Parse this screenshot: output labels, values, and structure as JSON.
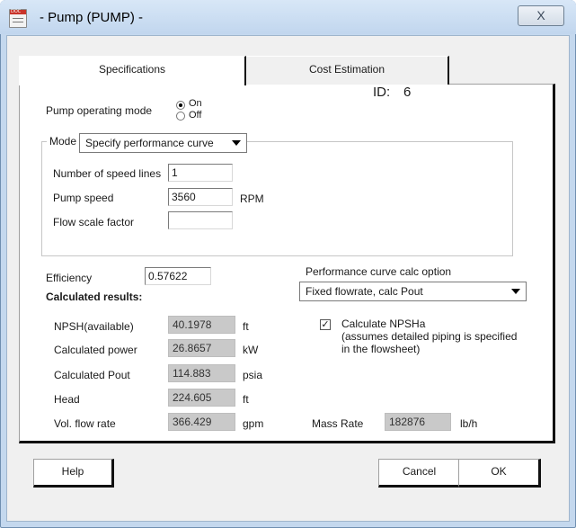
{
  "window": {
    "title": "- Pump (PUMP) -",
    "close_glyph": "X",
    "app_icon": "document-icon"
  },
  "tabs": [
    {
      "label": "Specifications"
    },
    {
      "label": "Cost Estimation"
    }
  ],
  "id": {
    "label": "ID:",
    "value": "6"
  },
  "operating_mode": {
    "label": "Pump operating mode",
    "options": [
      "On",
      "Off"
    ],
    "selected": "On"
  },
  "mode": {
    "label": "Mode",
    "selected": "Specify performance curve"
  },
  "inputs": {
    "speed_lines": {
      "label": "Number of speed lines",
      "value": "1"
    },
    "pump_speed": {
      "label": "Pump speed",
      "value": "3560",
      "unit": "RPM"
    },
    "flow_scale": {
      "label": "Flow scale factor",
      "value": ""
    }
  },
  "efficiency": {
    "label": "Efficiency",
    "value": "0.57622"
  },
  "calc_option": {
    "label": "Performance curve calc option",
    "selected": "Fixed flowrate, calc Pout"
  },
  "results": {
    "heading": "Calculated results:",
    "rows": [
      {
        "label": "NPSH(available)",
        "value": "40.1978",
        "unit": "ft"
      },
      {
        "label": "Calculated power",
        "value": "26.8657",
        "unit": "kW"
      },
      {
        "label": "Calculated Pout",
        "value": "114.883",
        "unit": "psia"
      },
      {
        "label": "Head",
        "value": "224.605",
        "unit": "ft"
      },
      {
        "label": "Vol. flow rate",
        "value": "366.429",
        "unit": "gpm"
      }
    ]
  },
  "npsha": {
    "checked": true,
    "line1": "Calculate NPSHa",
    "line2": "(assumes detailed piping is specified",
    "line3": "in the flowsheet)"
  },
  "mass_rate": {
    "label": "Mass Rate",
    "value": "182876",
    "unit": "lb/h"
  },
  "buttons": {
    "help": "Help",
    "cancel": "Cancel",
    "ok": "OK"
  },
  "colors": {
    "title_bar": "#c8dbf0",
    "panel": "#ffffff",
    "readonly_field": "#c9c9c9"
  }
}
